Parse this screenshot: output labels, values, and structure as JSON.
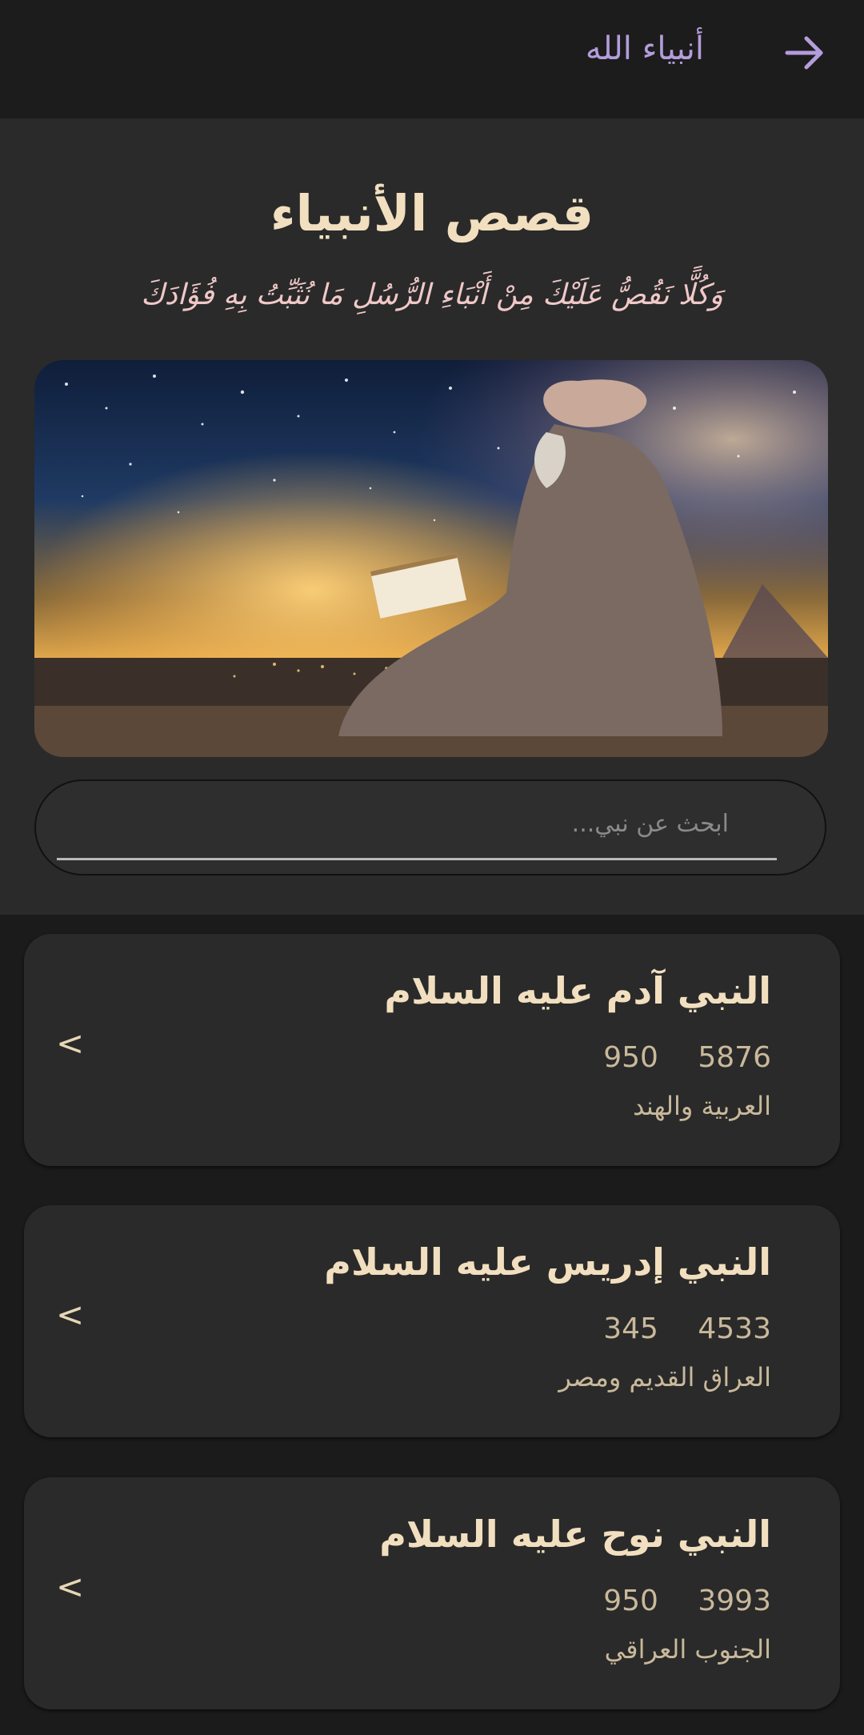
{
  "appbar": {
    "title": "أنبياء الله"
  },
  "header": {
    "title": "قصص الأنبياء",
    "verse": "وَكُلًّا نَقُصُّ عَلَيْكَ مِنْ أَنْبَاءِ الرُّسُلِ مَا نُثَبِّتُ بِهِ فُؤَادَكَ"
  },
  "search": {
    "placeholder": "ابحث عن نبي..."
  },
  "prophets": [
    {
      "name": "النبي آدم عليه السلام",
      "age": "950",
      "year": "5876",
      "region": "العربية والهند"
    },
    {
      "name": "النبي إدريس عليه السلام",
      "age": "345",
      "year": "4533",
      "region": "العراق القديم ومصر"
    },
    {
      "name": "النبي نوح عليه السلام",
      "age": "950",
      "year": "3993",
      "region": "الجنوب العراقي"
    }
  ],
  "colors": {
    "accent": "#b39ddb",
    "title": "#f1dfbf",
    "verse": "#f0c8c8",
    "card": "#2a2a2a"
  },
  "icons": {
    "back": "arrow-right-icon",
    "chevron": "chevron-left-icon"
  },
  "chevron_glyph": "<"
}
